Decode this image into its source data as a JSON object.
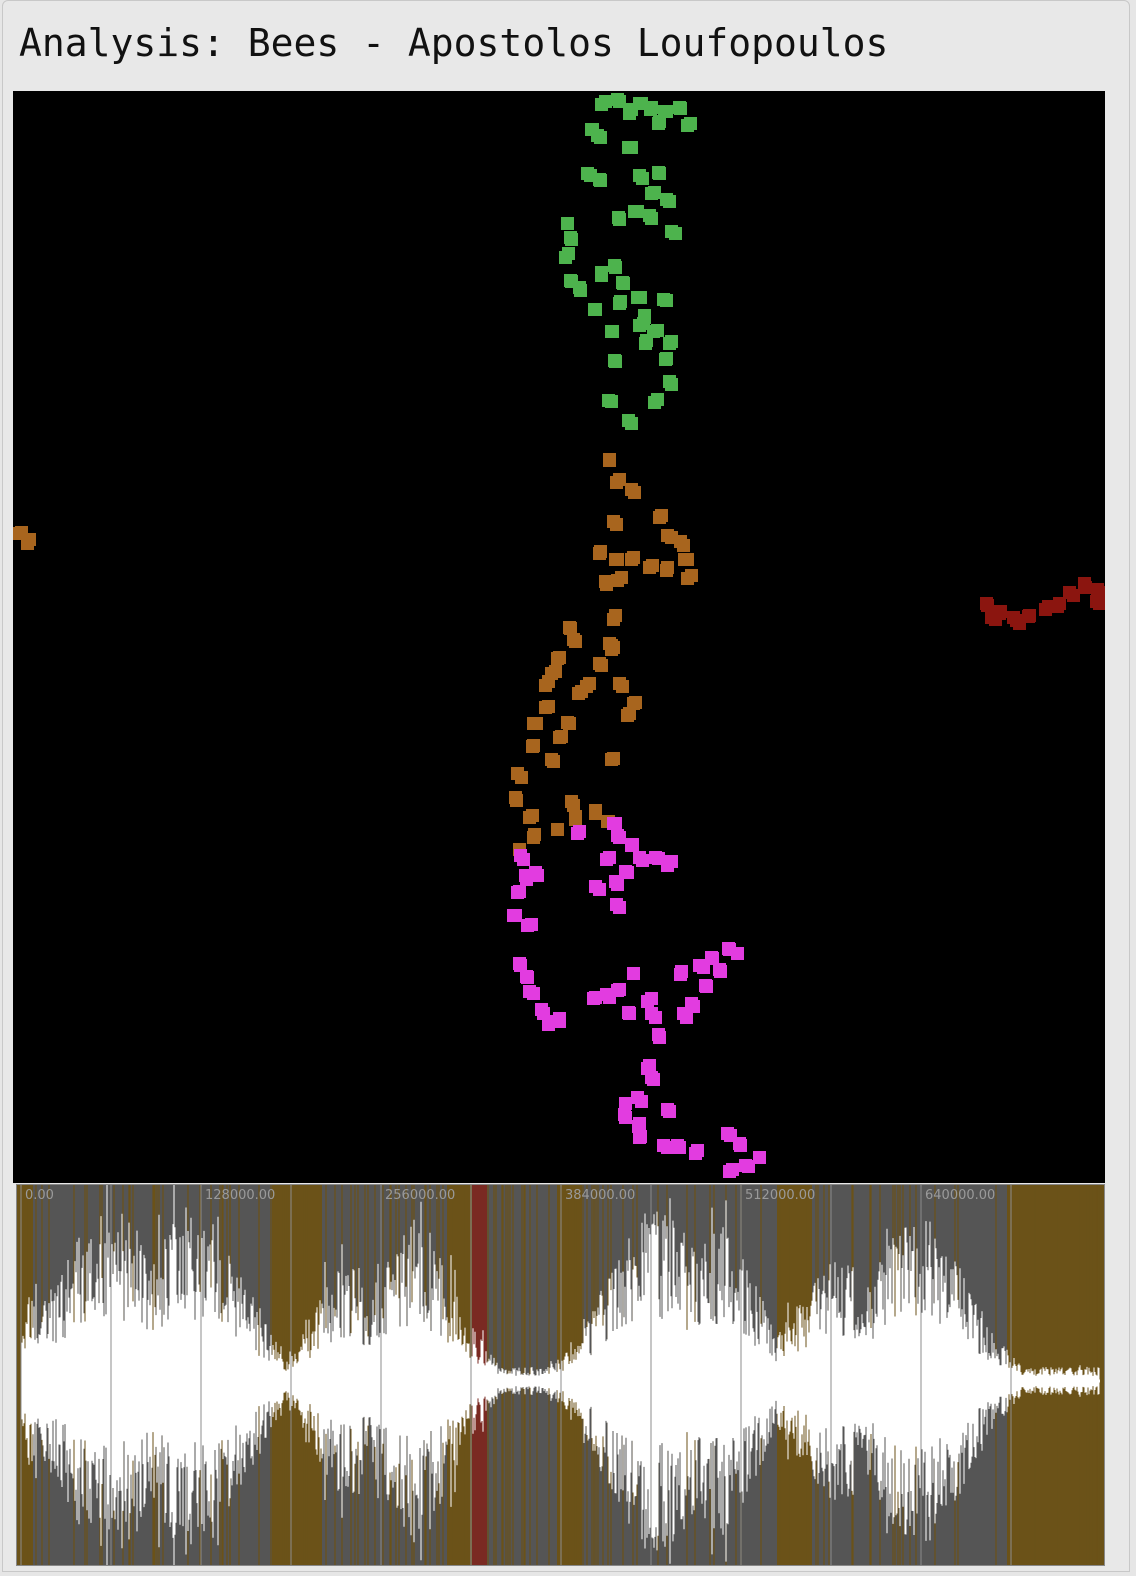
{
  "window": {
    "title": "Analysis: Bees - Apostolos Loufopoulos"
  },
  "colors": {
    "scatter_background": "#000000",
    "cluster_green": "#4db34d",
    "cluster_brown": "#a8651e",
    "cluster_dark_red": "#8b150f",
    "cluster_magenta": "#e23ce0",
    "waveform_background": "#555555",
    "waveform_signal": "#ffffff",
    "segment_overlay": "#6b5218",
    "playhead": "#7a2a22"
  },
  "waveform": {
    "tick_labels": [
      "0.00",
      "128000.00",
      "256000.00",
      "384000.00",
      "512000.00",
      "640000.00"
    ]
  }
}
